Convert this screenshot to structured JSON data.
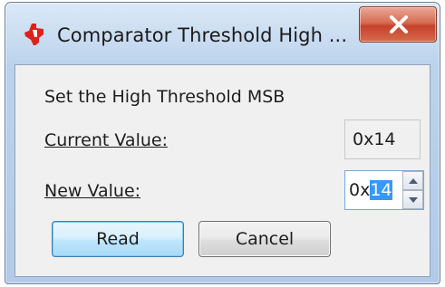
{
  "window": {
    "title": "Comparator Threshold High ...",
    "close_glyph": "x"
  },
  "dialog": {
    "prompt": "Set the High Threshold MSB",
    "current_label": "Current Value:",
    "current_value": "0x14",
    "new_label": "New Value:",
    "new_value_prefix": "0x",
    "new_value_selected": "14"
  },
  "buttons": {
    "read": "Read",
    "cancel": "Cancel"
  },
  "icons": {
    "app_logo": "ti-logo-icon",
    "close": "close-icon",
    "spin_up": "arrow-up-icon",
    "spin_down": "arrow-down-icon"
  },
  "colors": {
    "logo_red": "#e0201b",
    "close_red": "#c4422a",
    "selection": "#3399ff",
    "default_button_border": "#3c7fb1"
  }
}
